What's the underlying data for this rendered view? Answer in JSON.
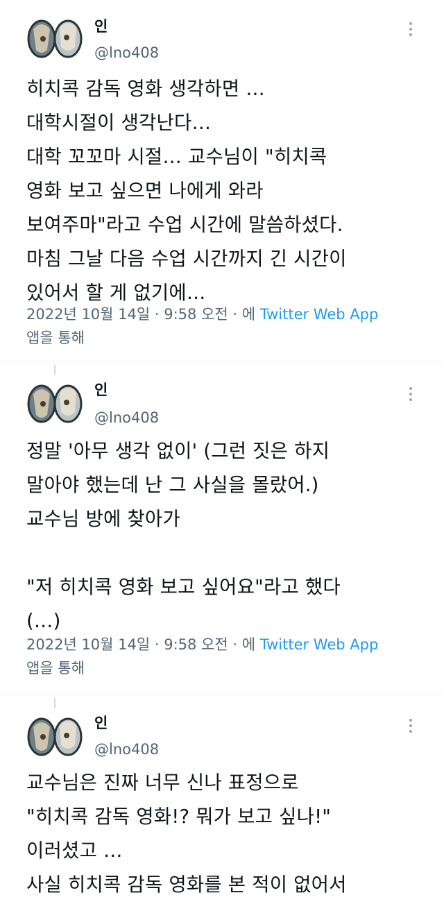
{
  "tweets": [
    {
      "name": "인",
      "handle": "@lno408",
      "text": "히치콕 감독 영화 생각하면 …\n대학시절이 생각난다…\n대학 꼬꼬마 시절… 교수님이 \"히치콕\n영화 보고 싶으면 나에게 와라\n보여주마\"라고 수업 시간에 말씀하셨다.\n마침 그날 다음 수업 시간까지 긴 시간이\n있어서 할 게 없기에…",
      "date": "2022년 10월 14일 · 9:58 오전 · 에",
      "source": "Twitter Web App",
      "via": "앱을 통해"
    },
    {
      "name": "인",
      "handle": "@lno408",
      "text": "정말 '아무 생각 없이' (그런 짓은 하지\n말아야 했는데 난 그 사실을 몰랐어.)\n교수님 방에 찾아가\n\n\"저 히치콕 영화 보고 싶어요\"라고 했다\n(…)",
      "date": "2022년 10월 14일 · 9:58 오전 · 에",
      "source": "Twitter Web App",
      "via": "앱을 통해"
    },
    {
      "name": "인",
      "handle": "@lno408",
      "text": "교수님은 진짜 너무 신나 표정으로\n\"히치콕 감독 영화!? 뭐가 보고 싶나!\"\n이러셨고 …\n사실 히치콕 감독 영화를 본 적이 없어서"
    }
  ],
  "colors": {
    "text": "#0f1419",
    "secondary": "#536471",
    "link": "#1d9bf0",
    "divider": "#eff3f4"
  },
  "icons": {
    "more": "more-options-icon",
    "avatar": "profile-avatar"
  }
}
